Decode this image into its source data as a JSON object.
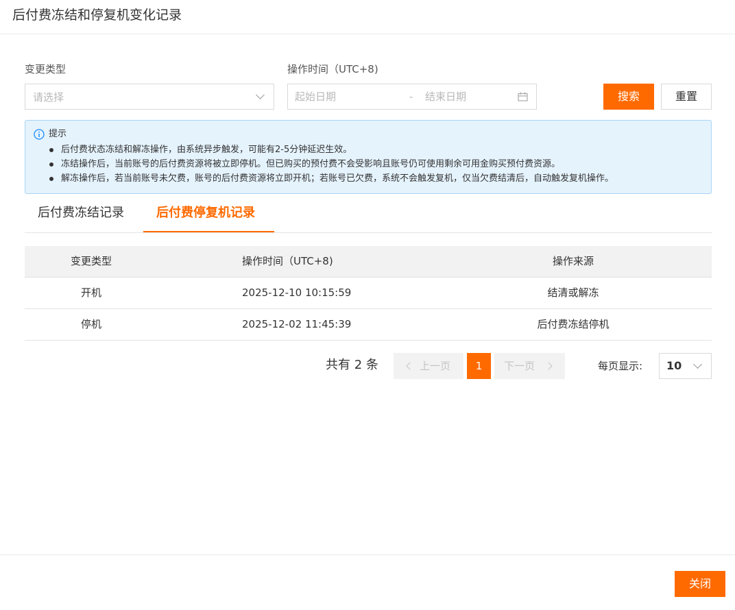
{
  "dialog": {
    "title": "后付费冻结和停复机变化记录",
    "close_label": "关闭"
  },
  "filters": {
    "change_type_label": "变更类型",
    "change_type_placeholder": "请选择",
    "op_time_label": "操作时间（UTC+8)",
    "start_date_placeholder": "起始日期",
    "date_separator": "-",
    "end_date_placeholder": "结束日期",
    "search_label": "搜索",
    "reset_label": "重置"
  },
  "notice": {
    "title": "提示",
    "items": [
      "后付费状态冻结和解冻操作，由系统异步触发，可能有2-5分钟延迟生效。",
      "冻结操作后，当前账号的后付费资源将被立即停机。但已购买的预付费不会受影响且账号仍可使用剩余可用金购买预付费资源。",
      "解冻操作后，若当前账号未欠费，账号的后付费资源将立即开机；若账号已欠费，系统不会触发复机，仅当欠费结清后，自动触发复机操作。"
    ]
  },
  "tabs": [
    {
      "label": "后付费冻结记录",
      "active": false
    },
    {
      "label": "后付费停复机记录",
      "active": true
    }
  ],
  "table": {
    "headers": [
      "变更类型",
      "操作时间（UTC+8)",
      "操作来源"
    ],
    "rows": [
      [
        "开机",
        "2025-12-10 10:15:59",
        "结清或解冻"
      ],
      [
        "停机",
        "2025-12-02 11:45:39",
        "后付费冻结停机"
      ]
    ]
  },
  "pagination": {
    "total_text": "共有 2 条",
    "prev_label": "上一页",
    "current_page": "1",
    "next_label": "下一页",
    "per_page_label": "每页显示:",
    "per_page_value": "10"
  },
  "colors": {
    "accent": "#ff6a00",
    "notice_bg": "#e5f3fd",
    "notice_border": "#a9d4f5",
    "info_icon": "#1a8cff"
  }
}
